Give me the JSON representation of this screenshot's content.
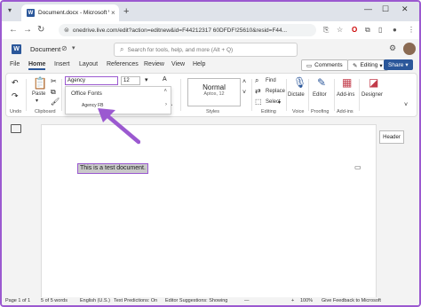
{
  "browser": {
    "tab_title": "Document.docx - Microsoft W...",
    "url": "onedrive.live.com/edit?action=editnew&id=F44212317 60DFDF!25610&resid=F44..."
  },
  "word": {
    "logo_letter": "W",
    "doc_name": "Document",
    "search_placeholder": "Search for tools, help, and more (Alt + Q)"
  },
  "menu": {
    "tabs": [
      "File",
      "Home",
      "Insert",
      "Layout",
      "References",
      "Review",
      "View",
      "Help"
    ],
    "comments": "Comments",
    "editing": "Editing",
    "share": "Share"
  },
  "ribbon": {
    "undo": "Undo",
    "paste": "Paste",
    "clipboard": "Clipboard",
    "font_value": "Agency",
    "size_value": "12",
    "style_name": "Normal",
    "style_sub": "Aptos, 12",
    "styles": "Styles",
    "find": "Find",
    "replace": "Replace",
    "select": "Select",
    "editing_group": "Editing",
    "dictate": "Dictate",
    "voice": "Voice",
    "editor": "Editor",
    "proofing": "Proofing",
    "addins": "Add-ins",
    "addins_group": "Add-ins",
    "designer": "Designer"
  },
  "font_dropdown": {
    "section": "Office Fonts",
    "item": "Agency FB"
  },
  "document": {
    "text": "This is a test document.",
    "header_button": "Header"
  },
  "status": {
    "page": "Page 1 of 1",
    "words": "5 of 5 words",
    "language": "English (U.S.)",
    "predictions": "Text Predictions: On",
    "editor_suggestions": "Editor Suggestions: Showing",
    "zoom": "100%",
    "feedback": "Give Feedback to Microsoft"
  },
  "colors": {
    "accent": "#9b59d0",
    "word_blue": "#2b579a"
  }
}
